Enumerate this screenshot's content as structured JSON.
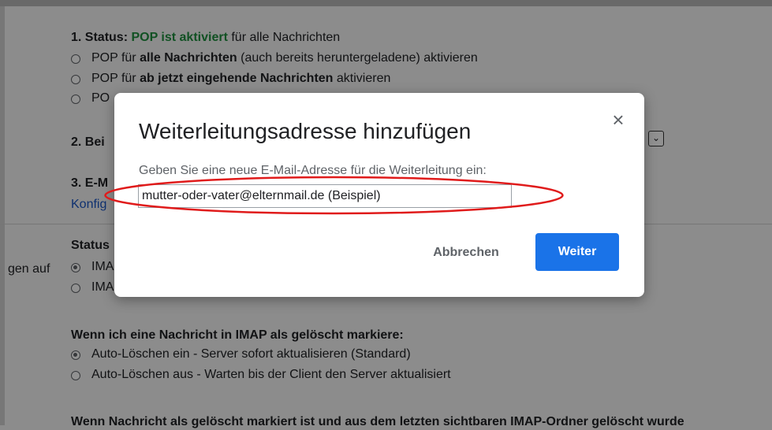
{
  "pop": {
    "status_prefix": "1. Status: ",
    "status_value": "POP ist aktiviert",
    "status_suffix": " für alle Nachrichten",
    "opt1_a": "POP für ",
    "opt1_b": "alle Nachrichten",
    "opt1_c": " (auch bereits heruntergeladene) aktivieren",
    "opt2_a": "POP für ",
    "opt2_b": "ab jetzt eingehende Nachrichten",
    "opt2_c": " aktivieren",
    "opt3_partial": "PO",
    "section2_partial": "2. Bei",
    "section3_partial": "3. E-M",
    "config_link_partial": "Konfig"
  },
  "imap": {
    "left_label_partial": "gen auf",
    "status_partial": "Status",
    "opt1_partial": "IMA",
    "opt2_partial": "IMA",
    "delete_heading": "Wenn ich eine Nachricht in IMAP als gelöscht markiere:",
    "auto_delete_on": "Auto-Löschen ein - Server sofort aktualisieren (Standard)",
    "auto_delete_off": "Auto-Löschen aus - Warten bis der Client den Server aktualisiert",
    "expunge_heading_partial": "Wenn Nachricht als gelöscht markiert ist und aus dem letzten sichtbaren IMAP-Ordner gelöscht wurde"
  },
  "dialog": {
    "title": "Weiterleitungsadresse hinzufügen",
    "close_glyph": "×",
    "label": "Geben Sie eine neue E-Mail-Adresse für die Weiterleitung ein:",
    "input_value": "mutter-oder-vater@elternmail.de (Beispiel)",
    "cancel_label": "Abbrechen",
    "next_label": "Weiter"
  },
  "icons": {
    "close": "close-icon",
    "dropdown": "chevron-down-icon"
  },
  "colors": {
    "accent": "#1a73e8",
    "status_green": "#1e8e3e",
    "annotation_red": "#e01b1b"
  }
}
